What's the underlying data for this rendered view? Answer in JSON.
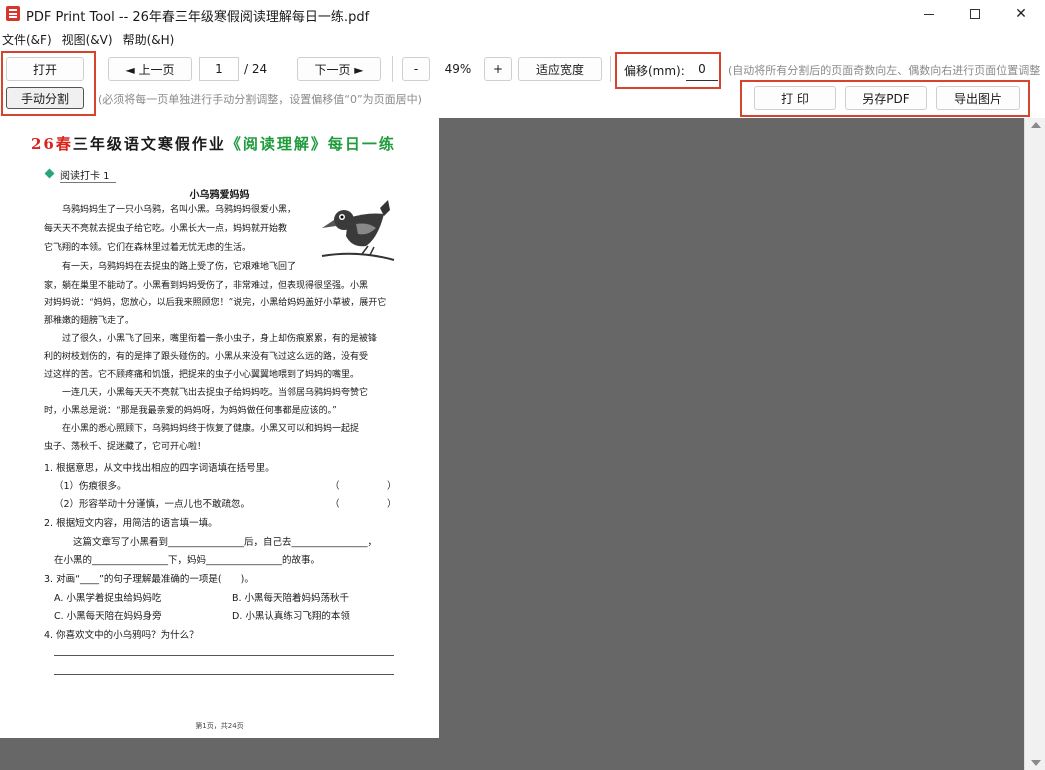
{
  "window": {
    "title": "PDF Print Tool -- 26年春三年级寒假阅读理解每日一练.pdf"
  },
  "menu": [
    "文件(&F)",
    "视图(&V)",
    "帮助(&H)"
  ],
  "toolbar": {
    "open_label": "打开",
    "split_label": "手动分割",
    "split_hint": "(必须将每一页单独进行手动分割调整，设置偏移值“0”为页面居中)",
    "prev_label": "◄ 上一页",
    "page_current": "1",
    "page_total": "/ 24",
    "next_label": "下一页 ►",
    "zoom_out_label": "-",
    "zoom_value": "49%",
    "zoom_in_label": "+",
    "fit_label": "适应宽度",
    "offset_label": "偏移(mm):",
    "offset_value": "0",
    "offset_hint": "(自动将所有分割后的页面奇数向左、偶数向右进行页面位置调整",
    "print_label": "打  印",
    "save_pdf_label": "另存PDF",
    "export_img_label": "导出图片"
  },
  "colors": {
    "highlight": "#d6442e",
    "viewer_bg": "#676767"
  },
  "document": {
    "title_red": "26春",
    "title_dark": "三年级语文寒假作业",
    "title_green": "《阅读理解》每日一练",
    "checkin": "阅读打卡 1",
    "story_title": "小乌鸦爱妈妈",
    "paragraphs": [
      "　　乌鸦妈妈生了一只小乌鸦，名叫小黑。乌鸦妈妈很爱小黑，",
      "每天天不亮就去捉虫子给它吃。小黑长大一点，妈妈就开始教",
      "它飞翔的本领。它们在森林里过着无忧无虑的生活。",
      "　　有一天，乌鸦妈妈在去捉虫的路上受了伤，它艰难地飞回了",
      "家，躺在巢里不能动了。小黑看到妈妈受伤了，非常难过，但表现得很坚强。小黑",
      "对妈妈说：“妈妈，您放心，以后我来照顾您！”说完，小黑给妈妈盖好小草被，展开它",
      "那稚嫩的翅膀飞走了。",
      "　　过了很久，小黑飞了回来，嘴里衔着一条小虫子，身上却伤痕累累，有的是被锋",
      "利的树枝划伤的，有的是摔了跟头碰伤的。小黑从来没有飞过这么远的路，没有受",
      "过这样的苦。它不顾疼痛和饥饿，把捉来的虫子小心翼翼地喂到了妈妈的嘴里。",
      "　　一连几天，小黑每天天不亮就飞出去捉虫子给妈妈吃。当邻居乌鸦妈妈夸赞它",
      "时，小黑总是说：“那是我最亲爱的妈妈呀，为妈妈做任何事都是应该的。”",
      "　　在小黑的悉心照顾下，乌鸦妈妈终于恢复了健康。小黑又可以和妈妈一起捉",
      "虫子、荡秋千、捉迷藏了，它可开心啦！"
    ],
    "q1": "1. 根据意思，从文中找出相应的四字词语填在括号里。",
    "q1a": "（1）伤痕很多。",
    "q1b": "（2）形容举动十分谨慎，一点儿也不敢疏忽。",
    "bracket": "（　　　　　）",
    "q2": "2. 根据短文内容，用简洁的语言填一填。",
    "q2a": "　　这篇文章写了小黑看到________________后，自己去________________，",
    "q2b": "在小黑的________________下，妈妈________________的故事。",
    "q3": "3. 对画“____”的句子理解最准确的一项是(　　)。",
    "q3a": "A. 小黑学着捉虫给妈妈吃",
    "q3b": "B. 小黑每天陪着妈妈荡秋千",
    "q3c": "C. 小黑每天陪在妈妈身旁",
    "q3d": "D. 小黑认真练习飞翔的本领",
    "q4": "4. 你喜欢文中的小乌鸦吗？为什么？",
    "footer": "第1页，共24页"
  }
}
